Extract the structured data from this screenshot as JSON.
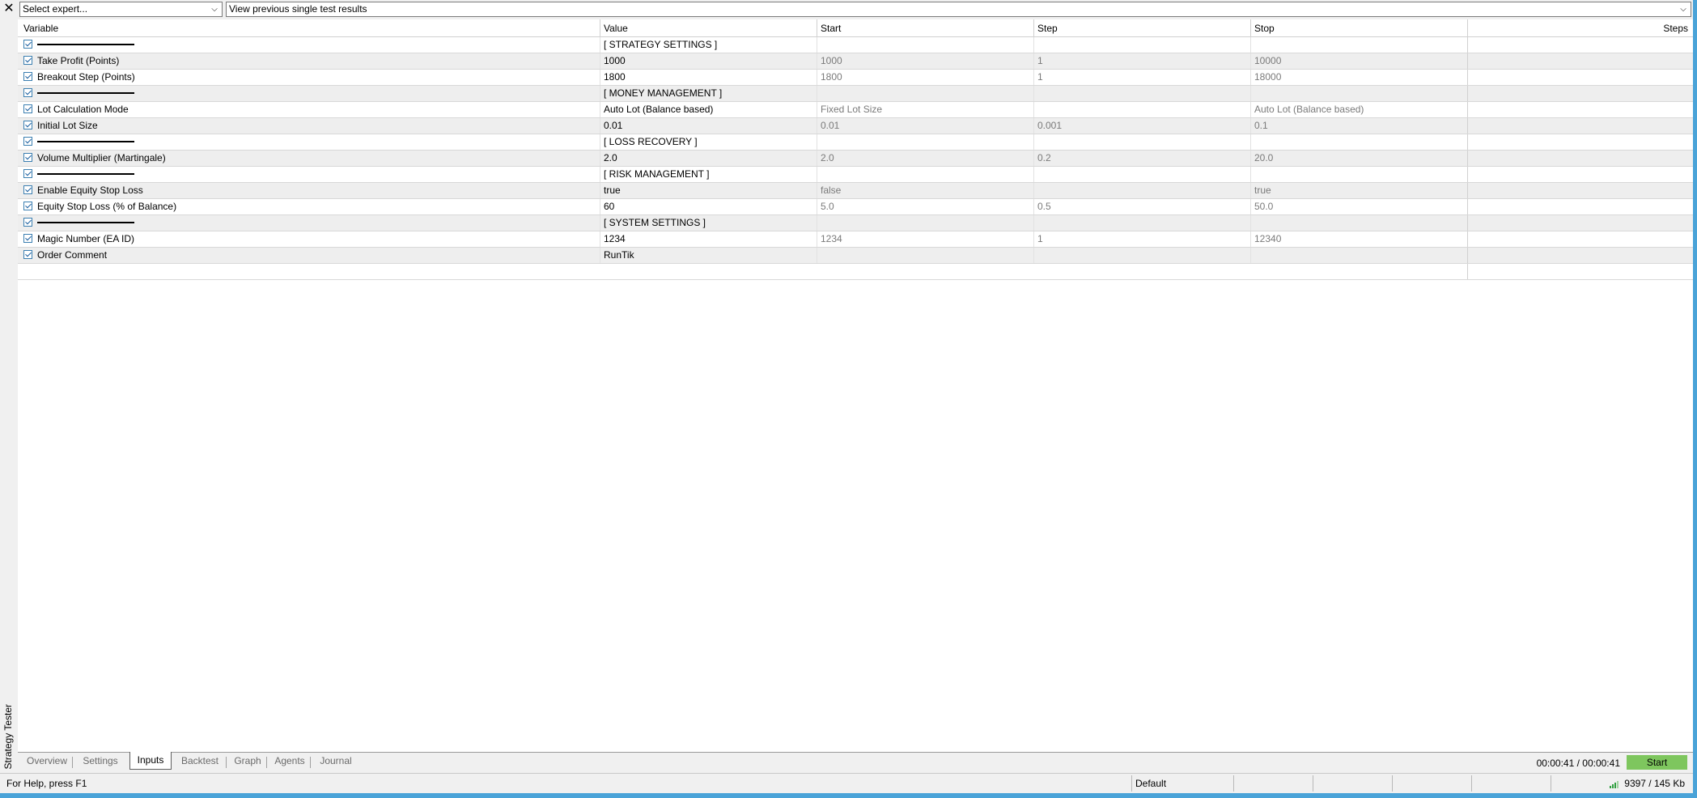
{
  "window": {
    "panel_title": "Strategy Tester",
    "close_glyph": "✕"
  },
  "toolbar": {
    "expert_select": "Select expert...",
    "history_select": "View previous single test results"
  },
  "grid": {
    "headers": {
      "variable": "Variable",
      "value": "Value",
      "start": "Start",
      "step": "Step",
      "stop": "Stop",
      "steps": "Steps"
    },
    "rows": [
      {
        "kind": "section",
        "value": "[ STRATEGY SETTINGS ]"
      },
      {
        "kind": "param",
        "variable": "Take Profit (Points)",
        "value": "1000",
        "start": "1000",
        "step": "1",
        "stop": "10000"
      },
      {
        "kind": "param",
        "variable": "Breakout Step (Points)",
        "value": "1800",
        "start": "1800",
        "step": "1",
        "stop": "18000"
      },
      {
        "kind": "section",
        "value": "[ MONEY MANAGEMENT ]"
      },
      {
        "kind": "param",
        "variable": "Lot Calculation Mode",
        "value": "Auto Lot (Balance based)",
        "start": "Fixed Lot Size",
        "step": "",
        "stop": "Auto Lot (Balance based)"
      },
      {
        "kind": "param",
        "variable": "Initial Lot Size",
        "value": "0.01",
        "start": "0.01",
        "step": "0.001",
        "stop": "0.1"
      },
      {
        "kind": "section",
        "value": "[ LOSS RECOVERY ]"
      },
      {
        "kind": "param",
        "variable": "Volume Multiplier (Martingale)",
        "value": "2.0",
        "start": "2.0",
        "step": "0.2",
        "stop": "20.0"
      },
      {
        "kind": "section",
        "value": "[ RISK MANAGEMENT ]"
      },
      {
        "kind": "param",
        "variable": "Enable Equity Stop Loss",
        "value": "true",
        "start": "false",
        "step": "",
        "stop": "true"
      },
      {
        "kind": "param",
        "variable": "Equity Stop Loss (% of Balance)",
        "value": "60",
        "start": "5.0",
        "step": "0.5",
        "stop": "50.0"
      },
      {
        "kind": "section",
        "value": "[ SYSTEM SETTINGS ]"
      },
      {
        "kind": "param",
        "variable": "Magic Number (EA ID)",
        "value": "1234",
        "start": "1234",
        "step": "1",
        "stop": "12340"
      },
      {
        "kind": "param",
        "variable": "Order Comment",
        "value": "RunTik",
        "start": "",
        "step": "",
        "stop": ""
      }
    ]
  },
  "tabs": [
    {
      "label": "Overview",
      "active": false
    },
    {
      "label": "Settings",
      "active": false
    },
    {
      "label": "Inputs",
      "active": true
    },
    {
      "label": "Backtest",
      "active": false
    },
    {
      "label": "Graph",
      "active": false
    },
    {
      "label": "Agents",
      "active": false
    },
    {
      "label": "Journal",
      "active": false
    }
  ],
  "run": {
    "timer": "00:00:41 / 00:00:41",
    "start_label": "Start"
  },
  "status": {
    "help": "For Help, press F1",
    "profile": "Default",
    "network": "9397 / 145 Kb"
  },
  "colors": {
    "frame": "#4aa3d8",
    "start_button": "#7ec65e",
    "row_alt": "#eeeeee"
  }
}
